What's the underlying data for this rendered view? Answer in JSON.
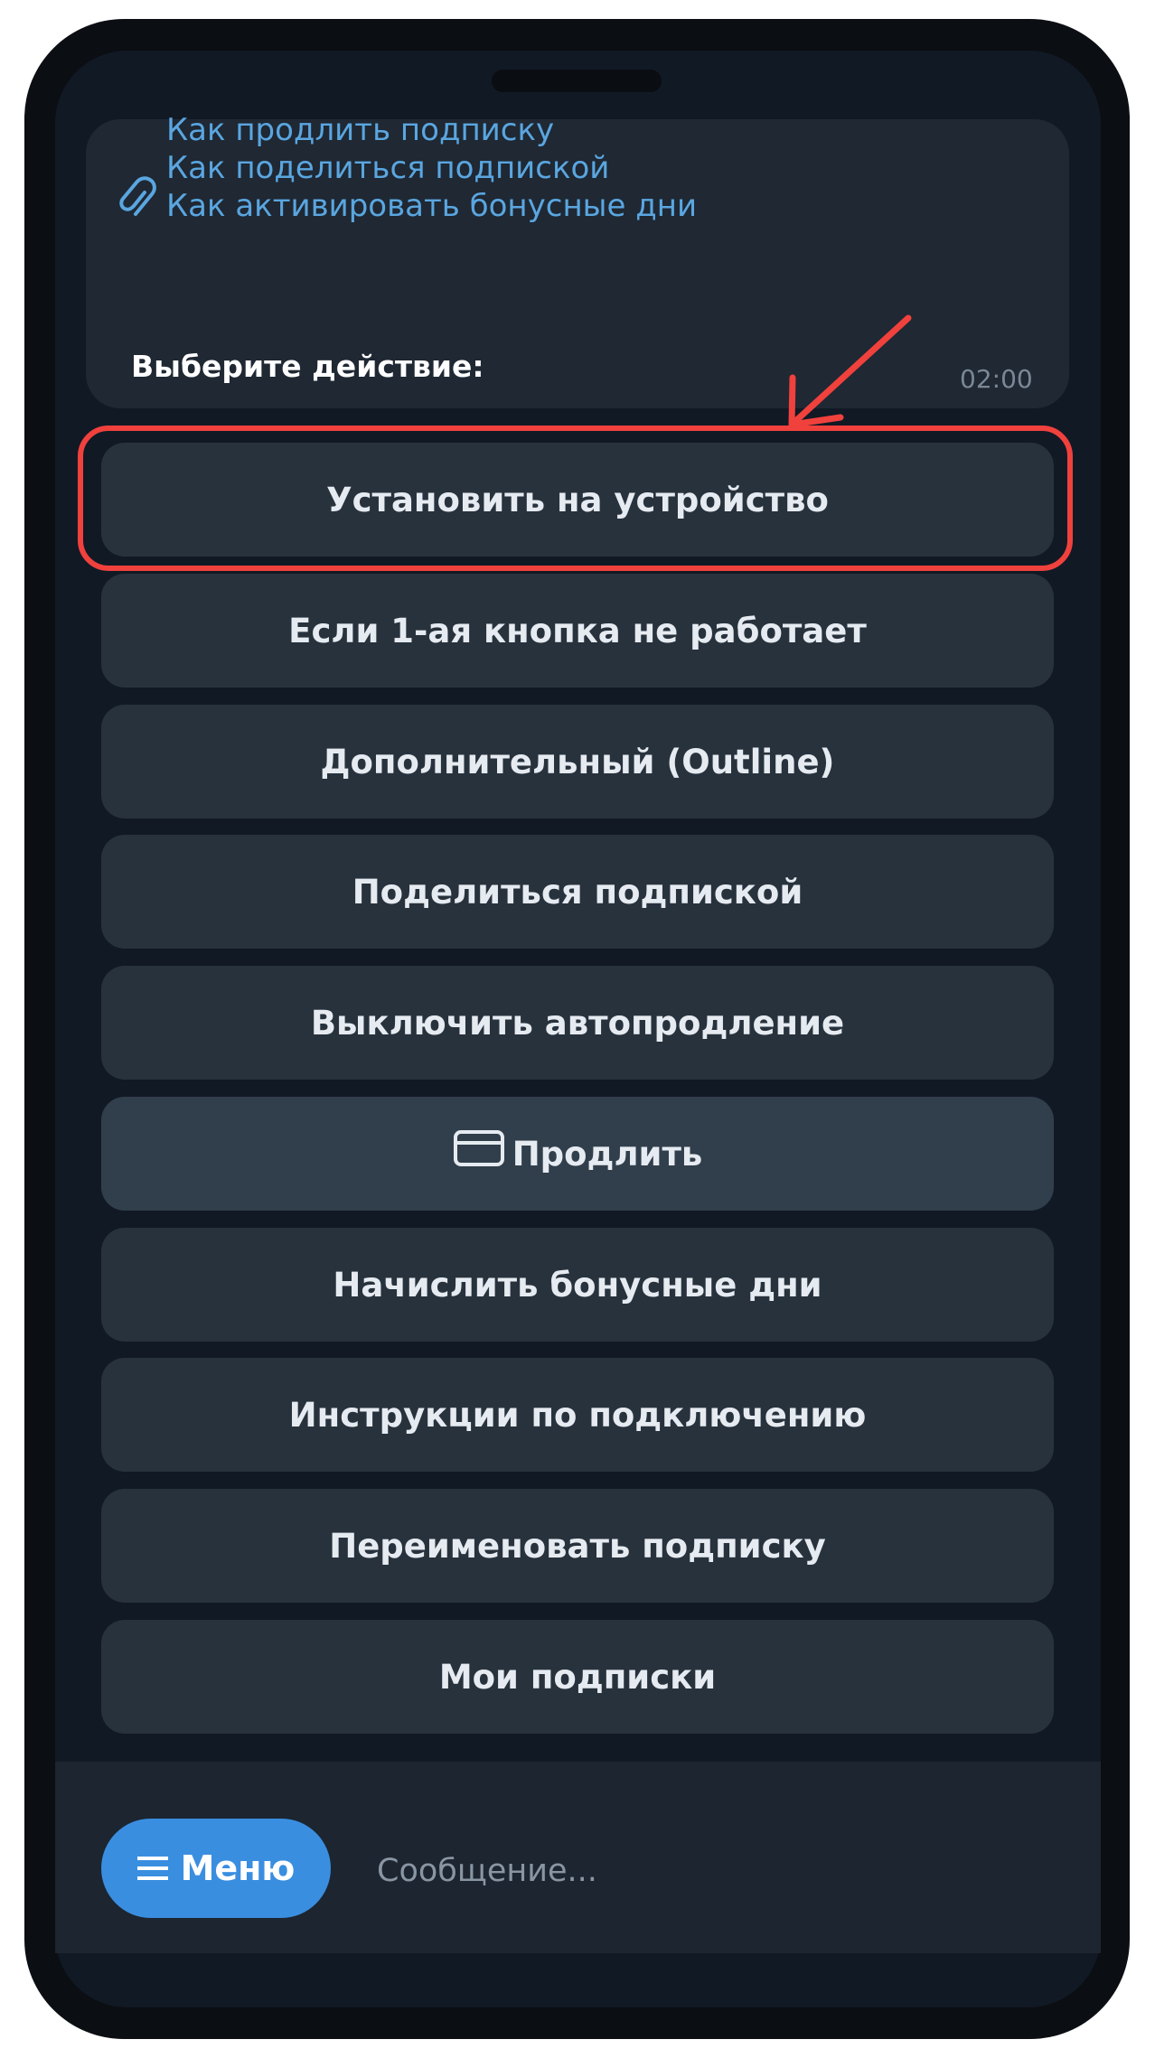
{
  "message": {
    "links": [
      "Как продлить подписку",
      "Как поделиться подпиской",
      "Как активировать бонусные дни"
    ],
    "prompt": "Выберите действие:",
    "time": "02:00"
  },
  "keyboard": {
    "buttons": [
      "Установить на устройство",
      "Если 1-ая кнопка не работает",
      "Дополнительный (Outline)",
      "Поделиться подпиской",
      "Выключить автопродление",
      "Продлить",
      "Начислить бонусные дни",
      "Инструкции по подключению",
      "Переименовать подписку",
      "Мои подписки"
    ],
    "highlighted_index": 0,
    "renew_icon": "credit-card-icon"
  },
  "bottom": {
    "menu_label": "Меню",
    "menu_icon": "hamburger-icon",
    "input_placeholder": "Сообщение..."
  },
  "colors": {
    "link": "#5aa6e0",
    "button_bg": "#28323d",
    "menu_button": "#3a8ee0",
    "annotation": "#f0413d"
  }
}
